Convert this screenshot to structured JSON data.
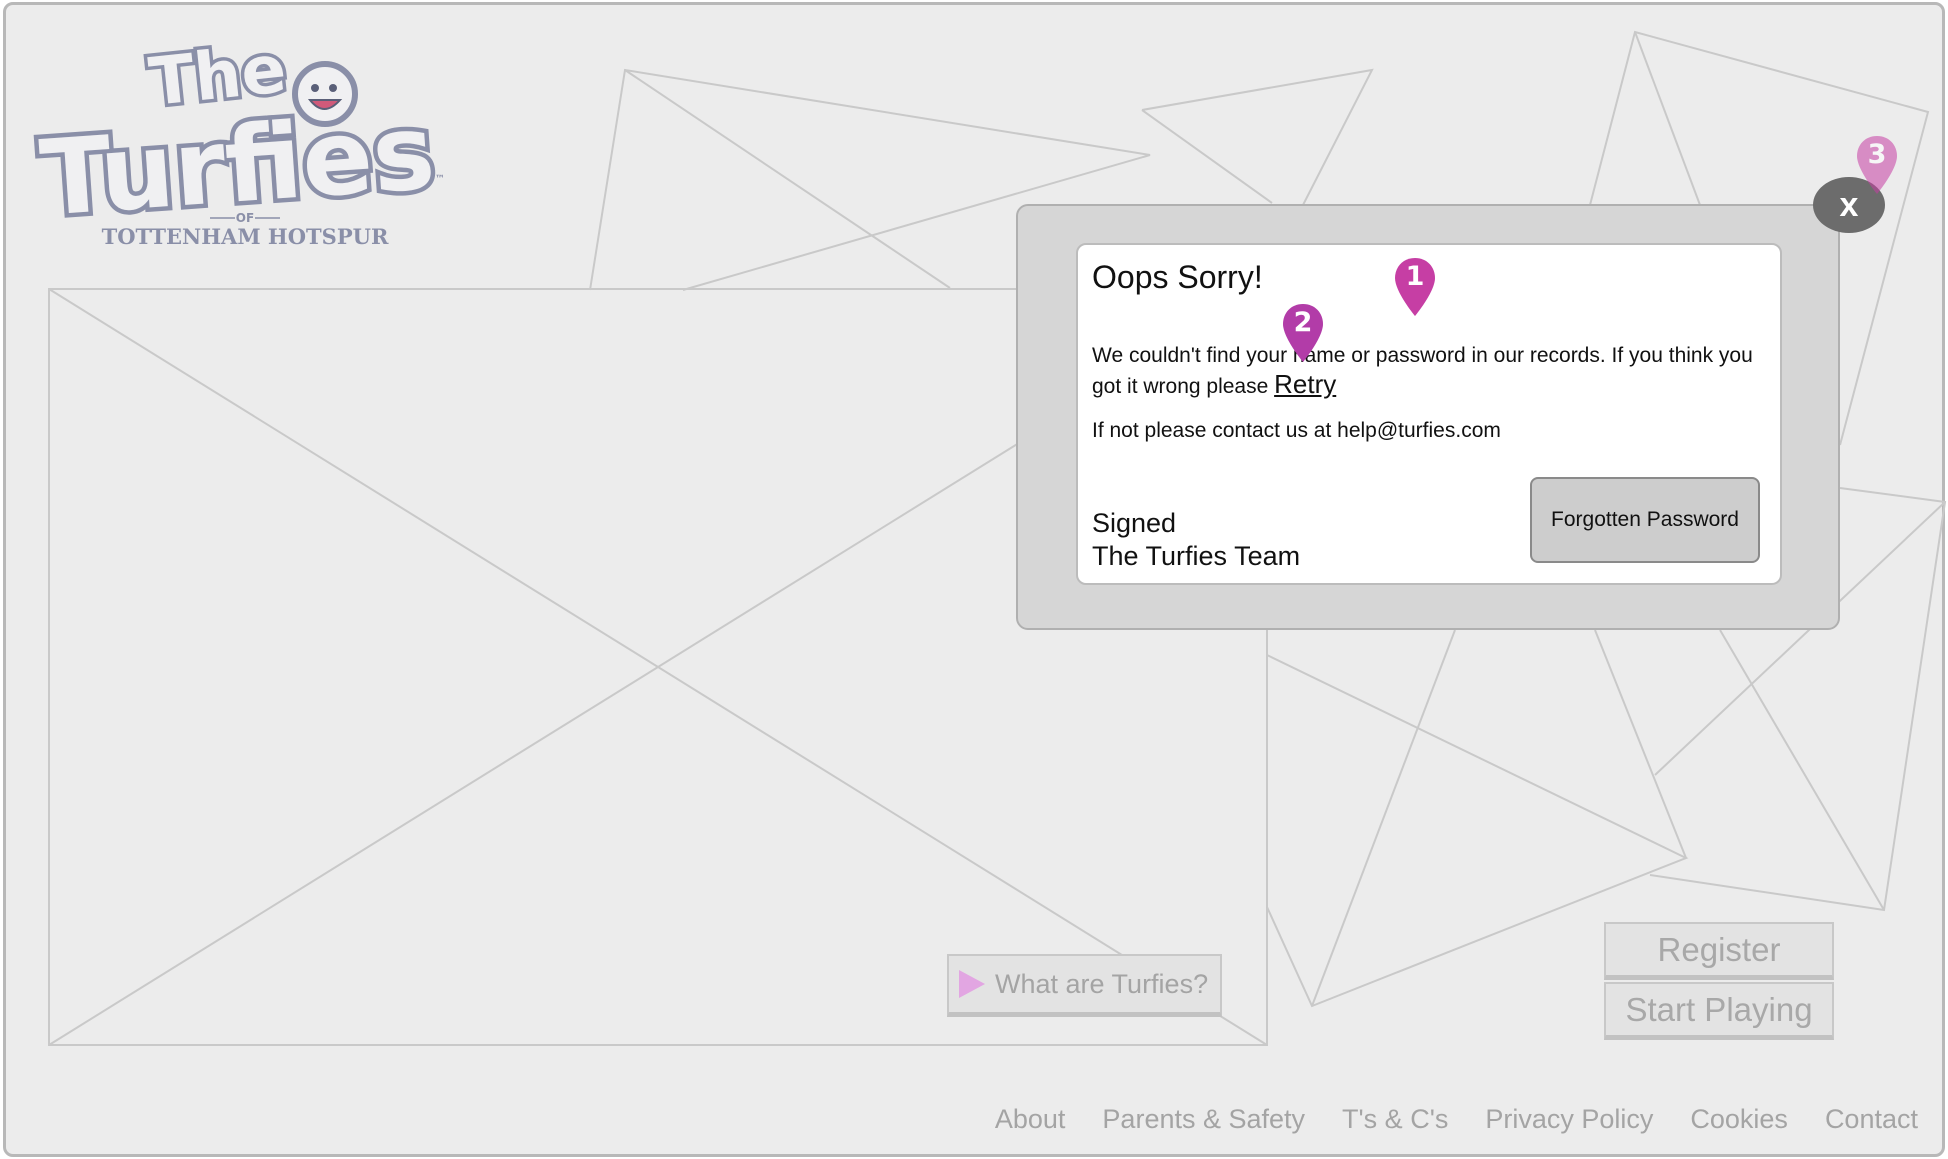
{
  "logo": {
    "line1": "The",
    "line2": "Turfies",
    "of": "OF",
    "club": "TOTTENHAM HOTSPUR",
    "tm": "™"
  },
  "dialog": {
    "title": "Oops Sorry!",
    "message_part1": "We couldn't find your name or password in our records. If you think you got it wrong please ",
    "retry_label": "Retry",
    "contact_text": "If not please contact us at help@turfies.com",
    "signed_line1": "Signed",
    "signed_line2": "The Turfies Team",
    "forgot_label": "Forgotten Password",
    "close_label": "x"
  },
  "buttons": {
    "what_label": "What are Turfies?",
    "register_label": "Register",
    "start_label": "Start Playing"
  },
  "footer": {
    "links": [
      "About",
      "Parents & Safety",
      "T's & C's",
      "Privacy Policy",
      "Cookies",
      "Contact"
    ]
  },
  "markers": [
    "1",
    "2",
    "3"
  ],
  "colors": {
    "marker": "#c63ea4",
    "marker_faded": "#dfa4d4",
    "play_icon": "#e2a6e2",
    "logo_fill": "#f0f0f2",
    "logo_outline": "#8a8fa8"
  }
}
